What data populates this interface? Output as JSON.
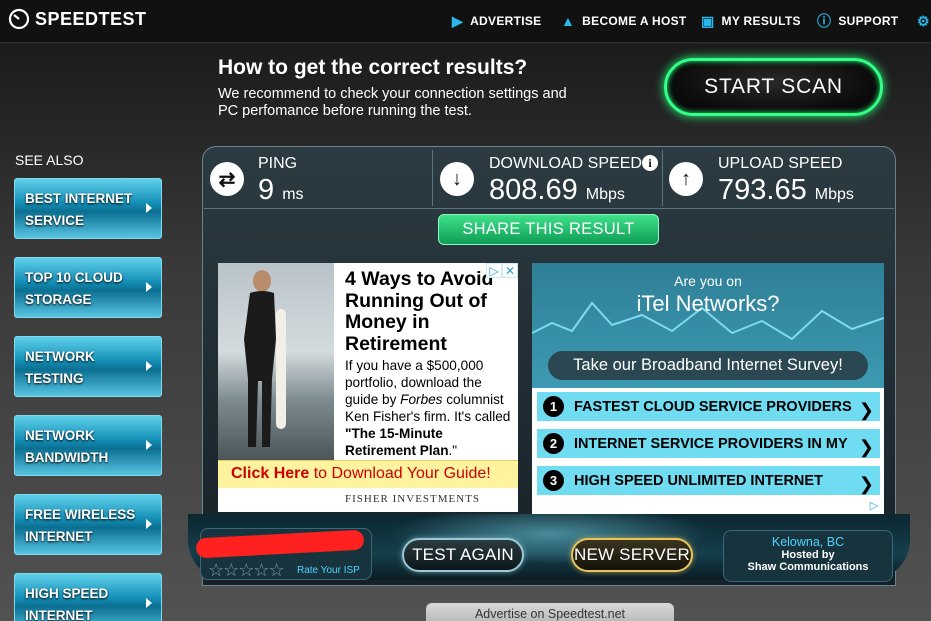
{
  "header": {
    "logo_text": "SPEEDTEST",
    "nav": [
      {
        "label": "ADVERTISE",
        "icon": "megaphone-icon"
      },
      {
        "label": "BECOME A HOST",
        "icon": "droplet-icon"
      },
      {
        "label": "MY RESULTS",
        "icon": "camera-icon"
      },
      {
        "label": "SUPPORT",
        "icon": "info-icon"
      }
    ]
  },
  "promo": {
    "heading": "How to get the correct results?",
    "body": "We recommend to check your connection settings and PC perfomance before running the test.",
    "cta": "START SCAN"
  },
  "sidebar": {
    "title": "SEE ALSO",
    "items": [
      {
        "line1": "BEST INTERNET",
        "line2": "SERVICE"
      },
      {
        "line1": "TOP 10 CLOUD",
        "line2": "STORAGE"
      },
      {
        "line1": "NETWORK",
        "line2": "TESTING"
      },
      {
        "line1": "NETWORK",
        "line2": "BANDWIDTH"
      },
      {
        "line1": "FREE WIRELESS",
        "line2": "INTERNET"
      },
      {
        "line1": "HIGH SPEED",
        "line2": "INTERNET"
      }
    ]
  },
  "results": {
    "ping": {
      "label": "PING",
      "value": "9",
      "unit": "ms"
    },
    "download": {
      "label": "DOWNLOAD SPEED",
      "value": "808.69",
      "unit": "Mbps"
    },
    "upload": {
      "label": "UPLOAD SPEED",
      "value": "793.65",
      "unit": "Mbps"
    },
    "share": "SHARE THIS RESULT"
  },
  "ad_left": {
    "title": "4 Ways to Avoid Running Out of Money in Retirement",
    "body_pre": "If you have a $500,000 portfolio, download the guide by ",
    "body_em": "Forbes",
    "body_mid": " columnist Ken Fisher's firm. It's called ",
    "body_bold": "\"The 15-Minute Retirement Plan",
    "body_end": ".\"",
    "cta_bold": "Click Here",
    "cta_rest": " to Download Your Guide!",
    "footer": "FISHER INVESTMENTS"
  },
  "ad_right": {
    "question": "Are you on",
    "isp": "iTel Networks?",
    "survey": "Take our Broadband Internet Survey!",
    "rows": [
      {
        "num": "1",
        "label": "FASTEST CLOUD SERVICE PROVIDERS"
      },
      {
        "num": "2",
        "label": "INTERNET SERVICE PROVIDERS IN MY"
      },
      {
        "num": "3",
        "label": "HIGH SPEED UNLIMITED INTERNET"
      }
    ]
  },
  "bottom": {
    "rate_isp": "Rate Your ISP",
    "stars": "☆☆☆☆☆",
    "test_again": "TEST AGAIN",
    "new_server": "NEW SERVER",
    "server_location": "Kelowna, BC",
    "hosted_by": "Hosted by",
    "host": "Shaw Communications",
    "advertise": "Advertise on Speedtest.net"
  },
  "colors": {
    "accent": "#29b6e8",
    "go_green": "#33ff88",
    "panel": "#1e2c33"
  }
}
